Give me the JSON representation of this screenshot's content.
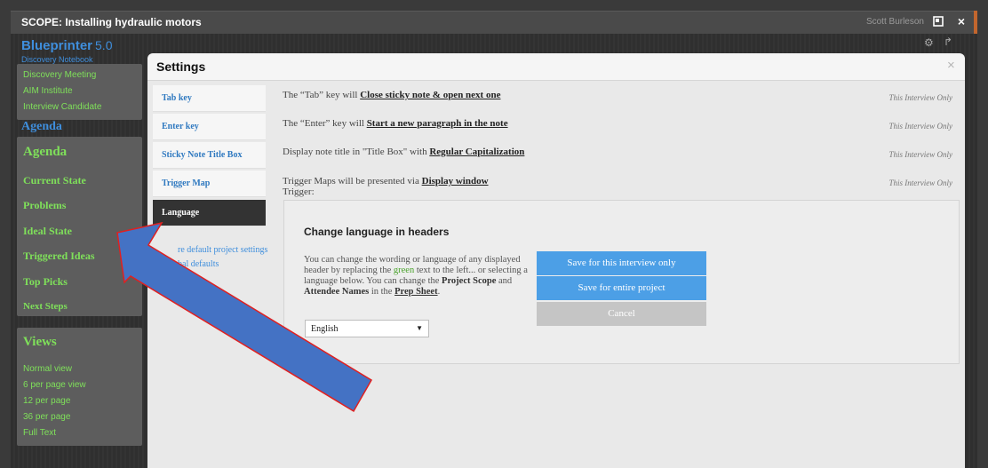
{
  "window": {
    "title": "SCOPE: Installing hydraulic motors",
    "user": "Scott Burleson",
    "popout_icon": "popout-icon",
    "close_icon": "close-icon"
  },
  "brand": {
    "name": "Blueprinter",
    "version": "5.0",
    "subtitle": "Discovery Notebook"
  },
  "sidebar": {
    "top_links": [
      "Discovery Meeting",
      "AIM Institute",
      "Interview Candidate"
    ],
    "agenda_faded": "Agenda",
    "agenda_heading": "Agenda",
    "agenda_items": [
      "Current State",
      "Problems",
      "Ideal State",
      "Triggered Ideas",
      "Top Picks",
      "Next Steps"
    ],
    "views_heading": "Views",
    "views_items": [
      "Normal view",
      "6 per page view",
      "12 per page",
      "36 per page",
      "Full Text"
    ]
  },
  "settings": {
    "title": "Settings",
    "close_glyph": "×",
    "tabs": [
      "Tab key",
      "Enter key",
      "Sticky Note Title Box",
      "Trigger Map",
      "Language"
    ],
    "restore_link": "re default project settings",
    "global_link": "bal defaults",
    "rows": [
      {
        "prefix": "The “Tab” key will ",
        "value": "Close sticky note & open next one",
        "scope": "This Interview Only"
      },
      {
        "prefix": "The “Enter” key will ",
        "value": "Start a new paragraph in the note",
        "scope": "This Interview Only"
      },
      {
        "prefix": "Display note title in \"Title Box\" with ",
        "value": "Regular Capitalization",
        "scope": "This Interview Only"
      },
      {
        "prefix": "Trigger Maps will be presented via ",
        "value": "Display window",
        "scope": "This Interview Only"
      }
    ],
    "trigger_sub": "Trigger:",
    "language": {
      "heading": "Change language in headers",
      "desc_1": "You can change the wording or language of any displayed header by replacing the ",
      "desc_green": "green",
      "desc_2": " text to the left... or selecting a language below. You can change the ",
      "desc_bold_1": "Project Scope",
      "desc_3": " and ",
      "desc_bold_2": "Attendee Names",
      "desc_4": " in the ",
      "desc_link": "Prep Sheet",
      "desc_5": ".",
      "selected": "English",
      "btn_interview": "Save for this interview only",
      "btn_project": "Save for entire project",
      "btn_cancel": "Cancel"
    }
  },
  "colors": {
    "accent_blue": "#4c9fe6",
    "sidebar_green": "#7fe05a",
    "arrow_fill": "#4472c4",
    "arrow_outline": "#e02020"
  }
}
